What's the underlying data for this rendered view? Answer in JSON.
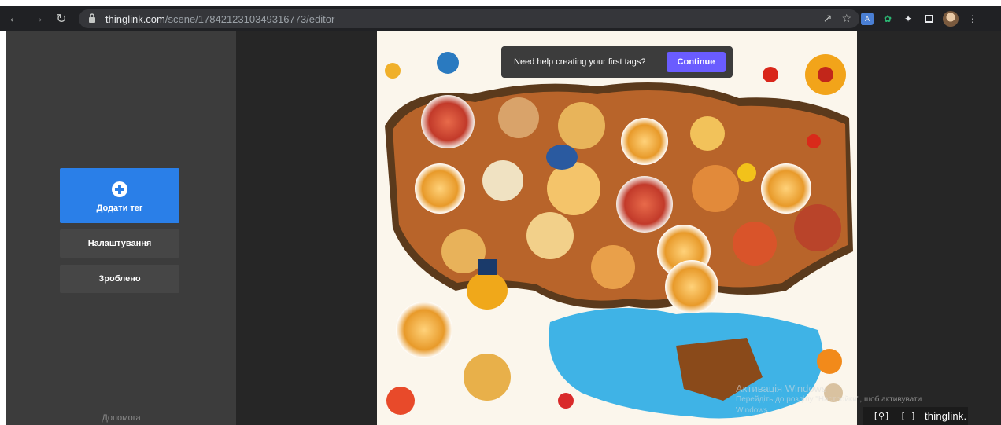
{
  "browser": {
    "url_host": "thinglink.com",
    "url_path": "/scene/1784212310349316773/editor",
    "icons": [
      "back-icon",
      "forward-icon",
      "reload-icon",
      "lock-icon",
      "share-icon",
      "star-icon",
      "extensions-icon",
      "sidepanel-icon",
      "menu-icon"
    ]
  },
  "sidebar": {
    "add_tag_label": "Додати тег",
    "settings_label": "Налаштування",
    "done_label": "Зроблено",
    "help_label": "Допомога"
  },
  "tooltip": {
    "text": "Need help creating your first tags?",
    "button_label": "Continue"
  },
  "watermark": {
    "line1": "Активація Windows",
    "line2": "Перейдіть до розділу \"Настройки\", щоб активувати",
    "line3": "Windows."
  },
  "bottom_bar": {
    "logo_text": "thinglink."
  },
  "colors": {
    "accent_blue": "#2a7fe8",
    "continue_purple": "#6a5cff",
    "sidebar_bg": "#3c3c3c",
    "canvas_bg": "#262626"
  }
}
